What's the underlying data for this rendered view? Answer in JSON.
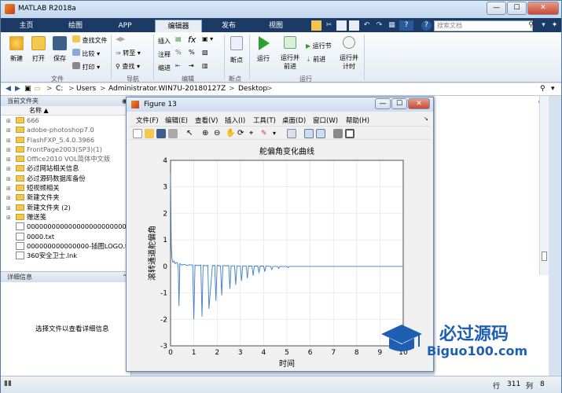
{
  "app": {
    "title": "MATLAB R2018a",
    "min": "—",
    "max": "☐",
    "close": "✕"
  },
  "tabs": [
    "主页",
    "绘图",
    "APP",
    "编辑器",
    "发布",
    "视图"
  ],
  "search": {
    "placeholder": "搜索文档"
  },
  "ribbon": {
    "new": "新建",
    "open": "打开",
    "save": "保存",
    "find_files": "查找文件",
    "compare": "比较",
    "print": "打印",
    "goto": "转至",
    "find": "查找",
    "insert": "插入",
    "comment": "注释",
    "indent": "缩进",
    "fx": "fx",
    "breakpoints": "断点",
    "run": "运行",
    "run_advance": "运行并前进",
    "run_section": "运行节",
    "advance": "前进",
    "run_time": "运行并计时",
    "groups": {
      "file": "文件",
      "nav": "导航",
      "edit": "编辑",
      "bp": "断点",
      "run": "运行"
    }
  },
  "address": {
    "parts": [
      "C:",
      "Users",
      "Administrator.WIN7U-20180127Z",
      "Desktop"
    ],
    "sep": ">"
  },
  "current_folder": {
    "title": "当前文件夹",
    "col_name": "名称",
    "sort": "▲",
    "items": [
      {
        "name": "666",
        "type": "folder"
      },
      {
        "name": "adobe-photoshop7.0",
        "type": "folder"
      },
      {
        "name": "FlashFXP_5.4.0.3966",
        "type": "folder"
      },
      {
        "name": "FrontPage2003(SP3)(1)",
        "type": "folder"
      },
      {
        "name": "Office2010 VOL简体中文版",
        "type": "folder"
      },
      {
        "name": "必过网站相关信息",
        "type": "folder"
      },
      {
        "name": "必过源码数据库备份",
        "type": "folder"
      },
      {
        "name": "短视频相关",
        "type": "folder"
      },
      {
        "name": "新建文件夹",
        "type": "folder"
      },
      {
        "name": "新建文件夹 (2)",
        "type": "folder"
      },
      {
        "name": "赠送笺",
        "type": "folder"
      },
      {
        "name": "0000000000000000000000000...",
        "type": "file"
      },
      {
        "name": "0000.txt",
        "type": "file"
      },
      {
        "name": "000000000000000-插图LOGO.f...",
        "type": "file"
      },
      {
        "name": "360安全卫士.lnk",
        "type": "file"
      }
    ]
  },
  "details": {
    "title": "详细信息",
    "message": "选择文件以查看详细信息"
  },
  "status": {
    "row_label": "行",
    "row": "311",
    "col_label": "列",
    "col": "8"
  },
  "figure": {
    "title": "Figure 13",
    "menus": [
      "文件(F)",
      "编辑(E)",
      "查看(V)",
      "插入(I)",
      "工具(T)",
      "桌面(D)",
      "窗口(W)",
      "帮助(H)"
    ]
  },
  "chart_data": {
    "type": "line",
    "title": "舵偏角变化曲线",
    "xlabel": "时间",
    "ylabel": "滚转通道舵偏角",
    "xlim": [
      0,
      10
    ],
    "ylim": [
      -3,
      4
    ],
    "xticks": [
      "0",
      "1",
      "2",
      "3",
      "4",
      "5",
      "6",
      "7",
      "8",
      "9",
      "10"
    ],
    "yticks": [
      "4",
      "3",
      "2",
      "1",
      "0",
      "-1",
      "-2",
      "-3"
    ],
    "grid": true,
    "color": "#3a7ec8",
    "series": [
      {
        "x": [
          0,
          0.03,
          0.06,
          0.1,
          0.15,
          0.2,
          0.25,
          0.3,
          0.33,
          0.36,
          0.4,
          0.5,
          0.6,
          0.7,
          0.8,
          0.95,
          1.0,
          1.05,
          1.2,
          1.3,
          1.35,
          1.4,
          1.55,
          1.6,
          1.65,
          1.8,
          1.9,
          1.95,
          2.0,
          2.15,
          2.2,
          2.25,
          2.4,
          2.5,
          2.55,
          2.6,
          2.75,
          2.8,
          2.85,
          3.0,
          3.05,
          3.1,
          3.25,
          3.3,
          3.35,
          3.5,
          3.55,
          3.6,
          3.75,
          3.8,
          3.85,
          4.0,
          4.05,
          4.1,
          4.3,
          4.35,
          4.4,
          4.6,
          4.65,
          4.7,
          5.0,
          5.05,
          5.1,
          6,
          7,
          8,
          9,
          10
        ],
        "y": [
          3.5,
          0.8,
          0.3,
          0.15,
          0.2,
          0.1,
          0.15,
          0.12,
          -0.1,
          -1.5,
          0.1,
          0.05,
          0.08,
          0.03,
          0.06,
          0.05,
          -2.0,
          0.05,
          0.03,
          0.05,
          -1.9,
          0.04,
          0.02,
          0.04,
          -1.6,
          0.03,
          0.04,
          -1.3,
          0.03,
          0.02,
          -1.1,
          0.03,
          0.02,
          0.03,
          -0.85,
          0.02,
          0.02,
          -0.7,
          0.02,
          0.01,
          -0.55,
          0.02,
          0.01,
          -0.45,
          0.01,
          0.01,
          -0.35,
          0.01,
          0.01,
          -0.25,
          0.01,
          0.01,
          -0.2,
          0.01,
          0.0,
          -0.12,
          0.0,
          0.0,
          -0.08,
          0.0,
          0.0,
          -0.05,
          0.0,
          0.0,
          0.0,
          0.0,
          0.0,
          0.0
        ]
      }
    ]
  },
  "watermark": {
    "brand": "必过源码",
    "url": "Biguo100.com"
  }
}
